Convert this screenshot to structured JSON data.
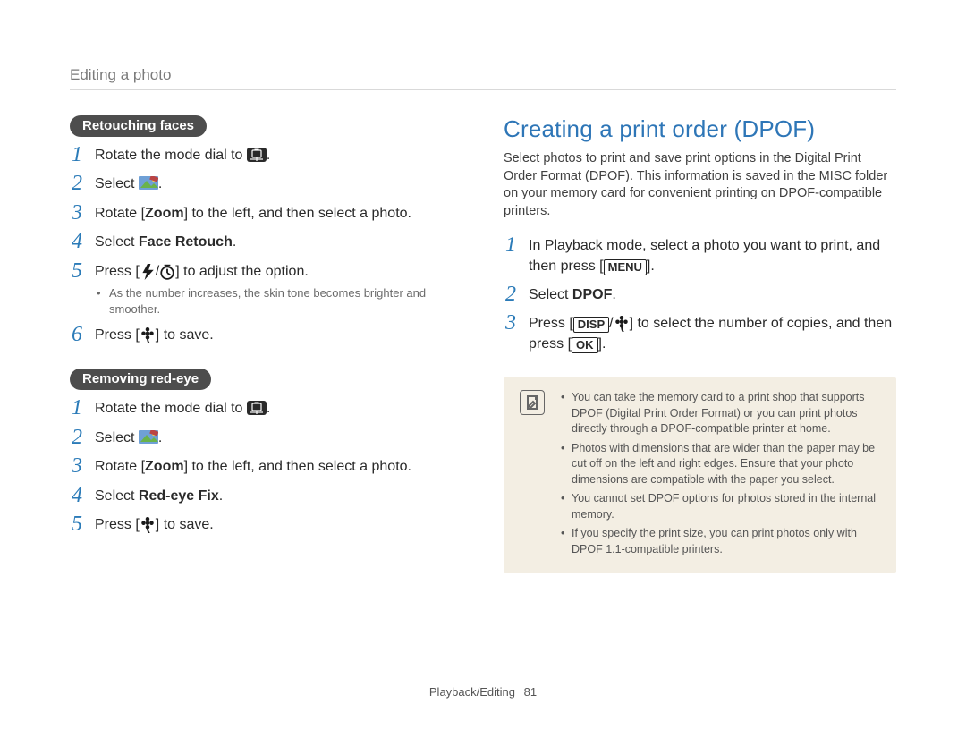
{
  "breadcrumb": "Editing a photo",
  "left": {
    "section_a": {
      "pill": "Retouching faces",
      "steps": [
        {
          "pre": "Rotate the mode dial to ",
          "icon": "mode-dial-icon",
          "post": "."
        },
        {
          "pre": "Select ",
          "icon": "picture-edit-icon",
          "post": "."
        },
        {
          "pre": "Rotate [",
          "bold": "Zoom",
          "post": "] to the left, and then select a photo."
        },
        {
          "pre": "Select ",
          "bold": "Face Retouch",
          "post": "."
        },
        {
          "pre": "Press [",
          "icon": "flash-icon",
          "mid": "/",
          "icon2": "timer-icon",
          "post": "] to adjust the option.",
          "sub": "As the number increases, the skin tone becomes brighter and smoother."
        },
        {
          "pre": "Press [",
          "icon": "flower-icon",
          "post": "] to save."
        }
      ]
    },
    "section_b": {
      "pill": "Removing red-eye",
      "steps": [
        {
          "pre": "Rotate the mode dial to ",
          "icon": "mode-dial-icon",
          "post": "."
        },
        {
          "pre": "Select ",
          "icon": "picture-edit-icon",
          "post": "."
        },
        {
          "pre": "Rotate [",
          "bold": "Zoom",
          "post": "] to the left, and then select a photo."
        },
        {
          "pre": "Select ",
          "bold": "Red-eye Fix",
          "post": "."
        },
        {
          "pre": "Press [",
          "icon": "flower-icon",
          "post": "] to save."
        }
      ]
    }
  },
  "right": {
    "title": "Creating a print order (DPOF)",
    "intro": "Select photos to print and save print options in the Digital Print Order Format (DPOF). This information is saved in the MISC folder on your memory card for convenient printing on DPOF-compatible printers.",
    "steps": [
      {
        "pre": "In Playback mode, select a photo you want to print, and then press [",
        "boxed": "MENU",
        "post": "]."
      },
      {
        "pre": "Select ",
        "bold": "DPOF",
        "post": "."
      },
      {
        "pre": "Press [",
        "boxed": "DISP",
        "mid": "/",
        "icon": "flower-icon",
        "post_mid": "] to select the number of copies, and then press [",
        "boxed2": "OK",
        "post": "]."
      }
    ],
    "notes": [
      "You can take the memory card to a print shop that supports DPOF (Digital Print Order Format) or you can print photos directly through a DPOF-compatible printer at home.",
      "Photos with dimensions that are wider than the paper may be cut off on the left and right edges. Ensure that your photo dimensions are compatible with the paper you select.",
      "You cannot set DPOF options for photos stored in the internal memory.",
      "If you specify the print size, you can print photos only with DPOF 1.1-compatible printers."
    ]
  },
  "footer": {
    "section": "Playback/Editing",
    "page": "81"
  }
}
